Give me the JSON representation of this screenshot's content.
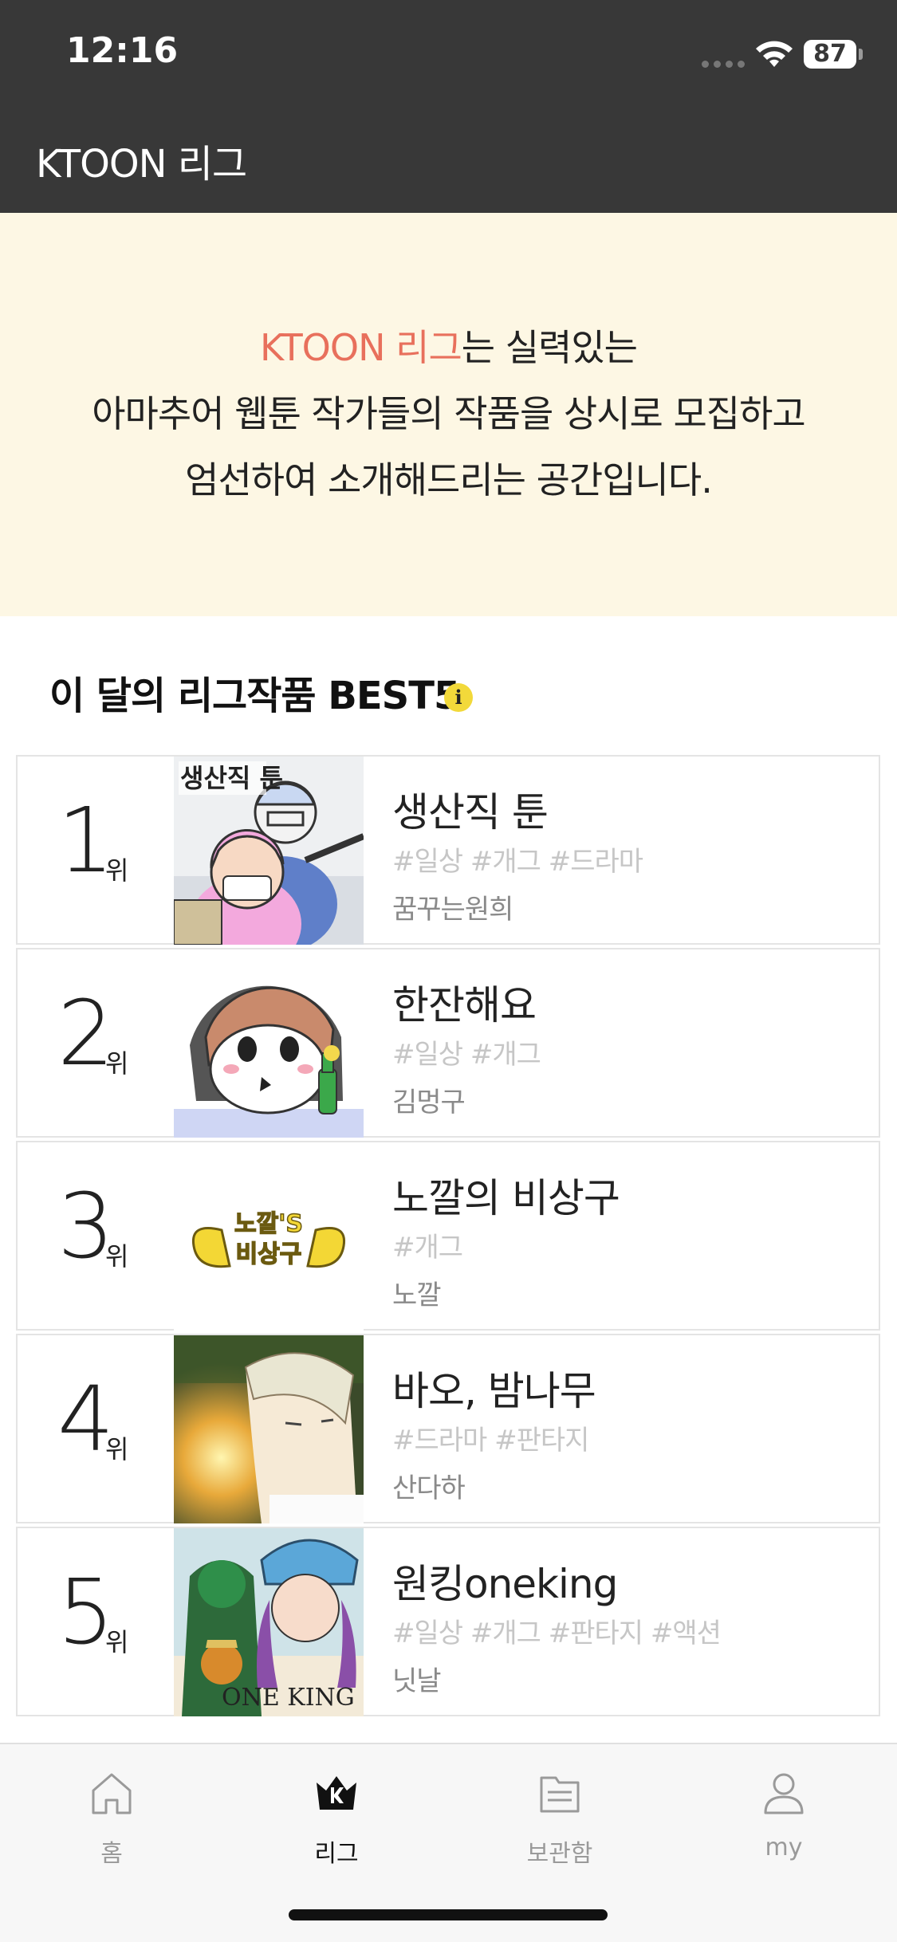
{
  "status_bar": {
    "time": "12:16",
    "battery": "87"
  },
  "header": {
    "title": "KTOON 리그"
  },
  "intro": {
    "highlight": "KTOON 리그",
    "line1_rest": "는 실력있는",
    "line2": "아마추어 웹툰 작가들의 작품을 상시로 모집하고",
    "line3": "엄선하여 소개해드리는 공간입니다.",
    "accent_color": "#e8705c"
  },
  "section": {
    "title": "이 달의 리그작품 BEST5",
    "info_icon": "i"
  },
  "rank_suffix": "위",
  "ranking": [
    {
      "rank": "1",
      "title": "생산직 툰",
      "tags": "#일상 #개그 #드라마",
      "author": "꿈꾸는원희",
      "thumb_icon": "factory-toon-thumbnail",
      "thumb_text": "생산직 툰"
    },
    {
      "rank": "2",
      "title": "한잔해요",
      "tags": "#일상 #개그",
      "author": "김멍구",
      "thumb_icon": "drinking-character-thumbnail"
    },
    {
      "rank": "3",
      "title": "노깔의 비상구",
      "tags": "#개그",
      "author": "노깔",
      "thumb_icon": "winged-logo-thumbnail",
      "thumb_text_top": "노깔'S",
      "thumb_text_bottom": "비상구"
    },
    {
      "rank": "4",
      "title": "바오, 밤나무",
      "tags": "#드라마 #판타지",
      "author": "산다하",
      "thumb_icon": "fantasy-portrait-thumbnail"
    },
    {
      "rank": "5",
      "title": "원킹oneking",
      "tags": "#일상 #개그 #판타지 #액션",
      "author": "닛날",
      "thumb_icon": "one-king-cover-thumbnail",
      "thumb_text": "ONE KING"
    }
  ],
  "tabbar": {
    "tabs": [
      {
        "label": "홈",
        "icon": "home-icon",
        "active": false
      },
      {
        "label": "리그",
        "icon": "league-crown-icon",
        "active": true
      },
      {
        "label": "보관함",
        "icon": "folder-icon",
        "active": false
      },
      {
        "label": "my",
        "icon": "user-icon",
        "active": false
      }
    ]
  }
}
